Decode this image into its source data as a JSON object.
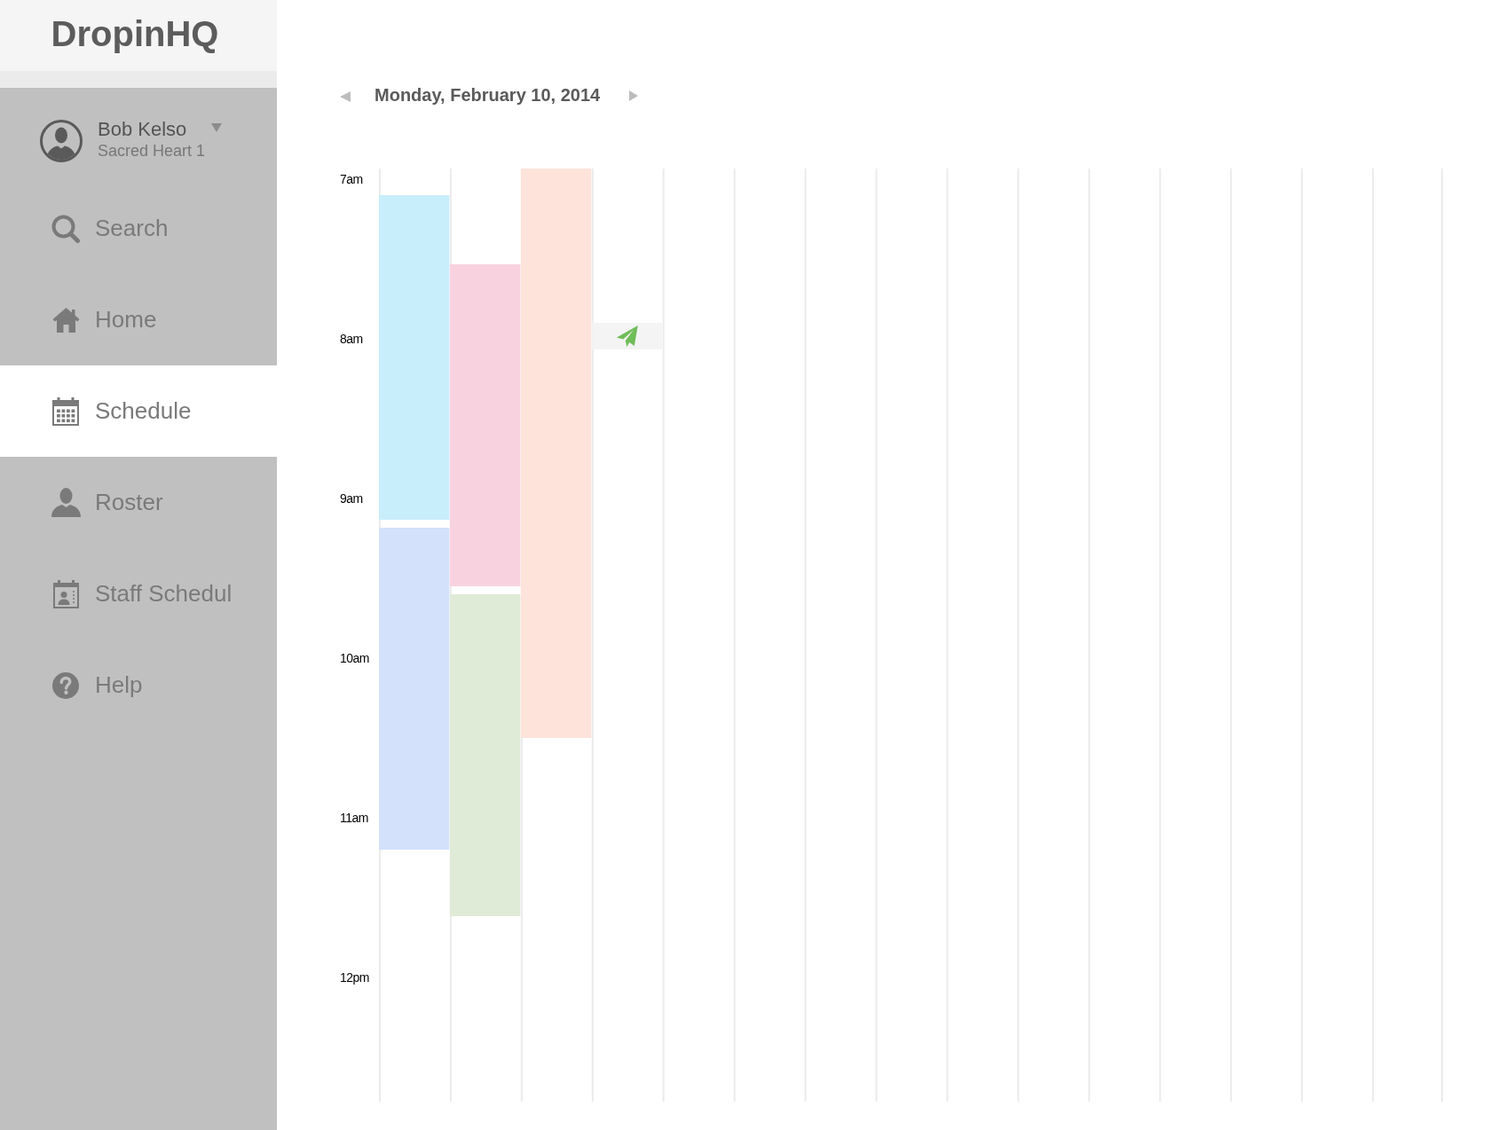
{
  "sidebar": {
    "logo": "DropinHQ",
    "user": {
      "name": "Bob Kelso",
      "subtitle": "Sacred Heart 1"
    },
    "items": [
      {
        "kind": "search",
        "label": "Search",
        "selected": false
      },
      {
        "kind": "home",
        "label": "Home",
        "selected": false
      },
      {
        "kind": "schedule",
        "label": "Schedule",
        "selected": true
      },
      {
        "kind": "roster",
        "label": "Roster",
        "selected": false
      },
      {
        "kind": "staff",
        "label": "Staff Schedul",
        "selected": false
      },
      {
        "kind": "help",
        "label": "Help",
        "selected": false
      }
    ]
  },
  "schedule": {
    "date": "Monday, February 10, 2014",
    "times": [
      "7am",
      "8am",
      "9am",
      "10am",
      "11am",
      "12pm"
    ],
    "columns": [
      {
        "events": [
          {
            "kind": "block",
            "color": "#c8eefc"
          },
          {
            "kind": "block",
            "color": "#d3e2fa"
          }
        ]
      },
      {
        "events": [
          {
            "kind": "block",
            "color": "#f9d2e0"
          },
          {
            "kind": "block",
            "color": "#e0ebd7"
          }
        ]
      },
      {
        "events": [
          {
            "kind": "block",
            "color": "#fde3da"
          }
        ]
      },
      {
        "events": [
          {
            "kind": "sent"
          }
        ]
      },
      {},
      {},
      {},
      {},
      {},
      {},
      {},
      {},
      {},
      {},
      {}
    ]
  }
}
